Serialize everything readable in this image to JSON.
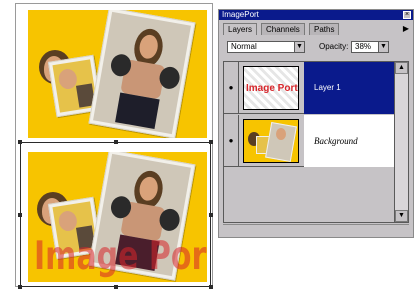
{
  "palette": {
    "title": "ImagePort",
    "close_glyph": "×",
    "tabs": [
      {
        "label": "Layers",
        "active": true
      },
      {
        "label": "Channels",
        "active": false
      },
      {
        "label": "Paths",
        "active": false
      }
    ],
    "menu_glyph": "▶",
    "blend_mode": "Normal",
    "opacity_label": "Opacity:",
    "opacity_value": "38%",
    "dropdown_glyph": "▼",
    "layers": [
      {
        "name": "Layer 1",
        "selected": true,
        "visible": true
      },
      {
        "name": "Background",
        "selected": false,
        "visible": true
      }
    ],
    "eye_glyph": "●",
    "scroll_up_glyph": "▲",
    "scroll_down_glyph": "▼"
  },
  "canvas": {
    "watermark_text": "Image Port"
  },
  "colors": {
    "background_yellow": "#f7c400",
    "watermark_red": "#d8262b",
    "selection_navy": "#0a1a8c",
    "titlebar_navy": "#0a1a8c",
    "skin": "#d9a27a",
    "hair": "#5a3e22",
    "glove_dark": "#2a2a2a",
    "pants": "#4a1e2c"
  }
}
